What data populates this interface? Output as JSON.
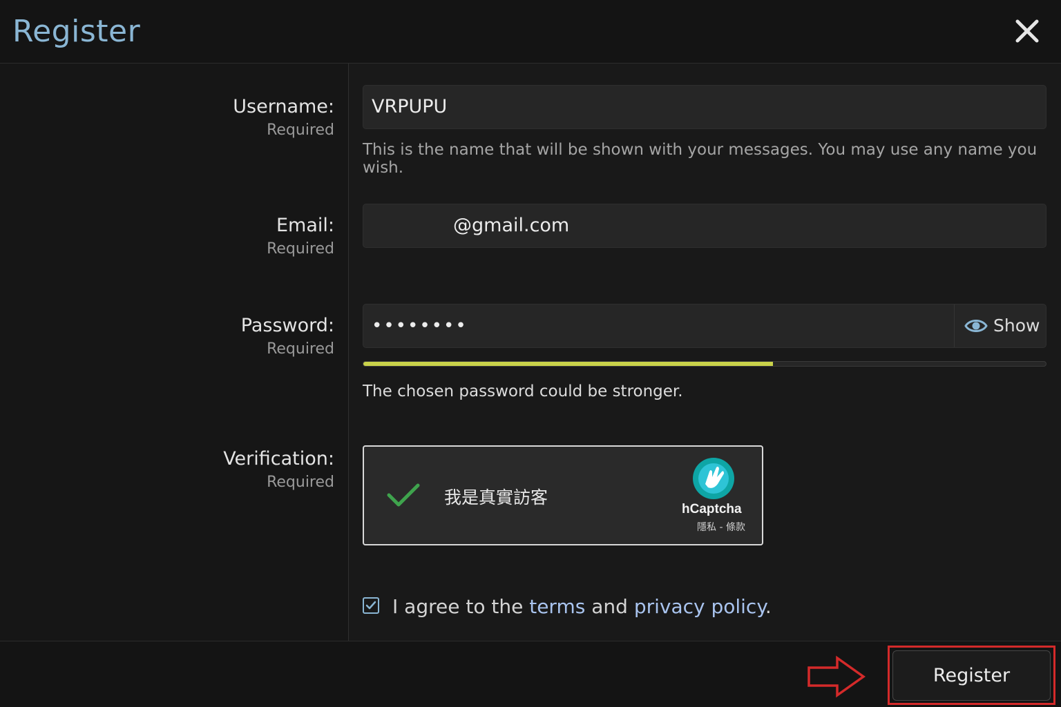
{
  "header": {
    "title": "Register",
    "close_icon": "close-icon"
  },
  "fields": {
    "username": {
      "label": "Username:",
      "required": "Required",
      "value": "VRPUPU",
      "hint": "This is the name that will be shown with your messages. You may use any name you wish."
    },
    "email": {
      "label": "Email:",
      "required": "Required",
      "value": "@gmail.com"
    },
    "password": {
      "label": "Password:",
      "required": "Required",
      "value": "••••••••",
      "show_label": "Show",
      "strength_fraction": 0.6,
      "strength_color": "#c9d24a",
      "strength_message": "The chosen password could be stronger."
    },
    "verification": {
      "label": "Verification:",
      "required": "Required",
      "captcha_text": "我是真實訪客",
      "brand": "hCaptcha",
      "links": "隱私 - 條款",
      "verified": true
    }
  },
  "agreement": {
    "checked": true,
    "prefix": "I agree to the",
    "terms": "terms",
    "and": "and",
    "privacy": "privacy policy",
    "suffix": "."
  },
  "footer": {
    "submit_label": "Register"
  },
  "colors": {
    "title": "#8ab6d4",
    "link": "#a9c4ef",
    "highlight": "#d42a2a",
    "check": "#3fa34d"
  }
}
